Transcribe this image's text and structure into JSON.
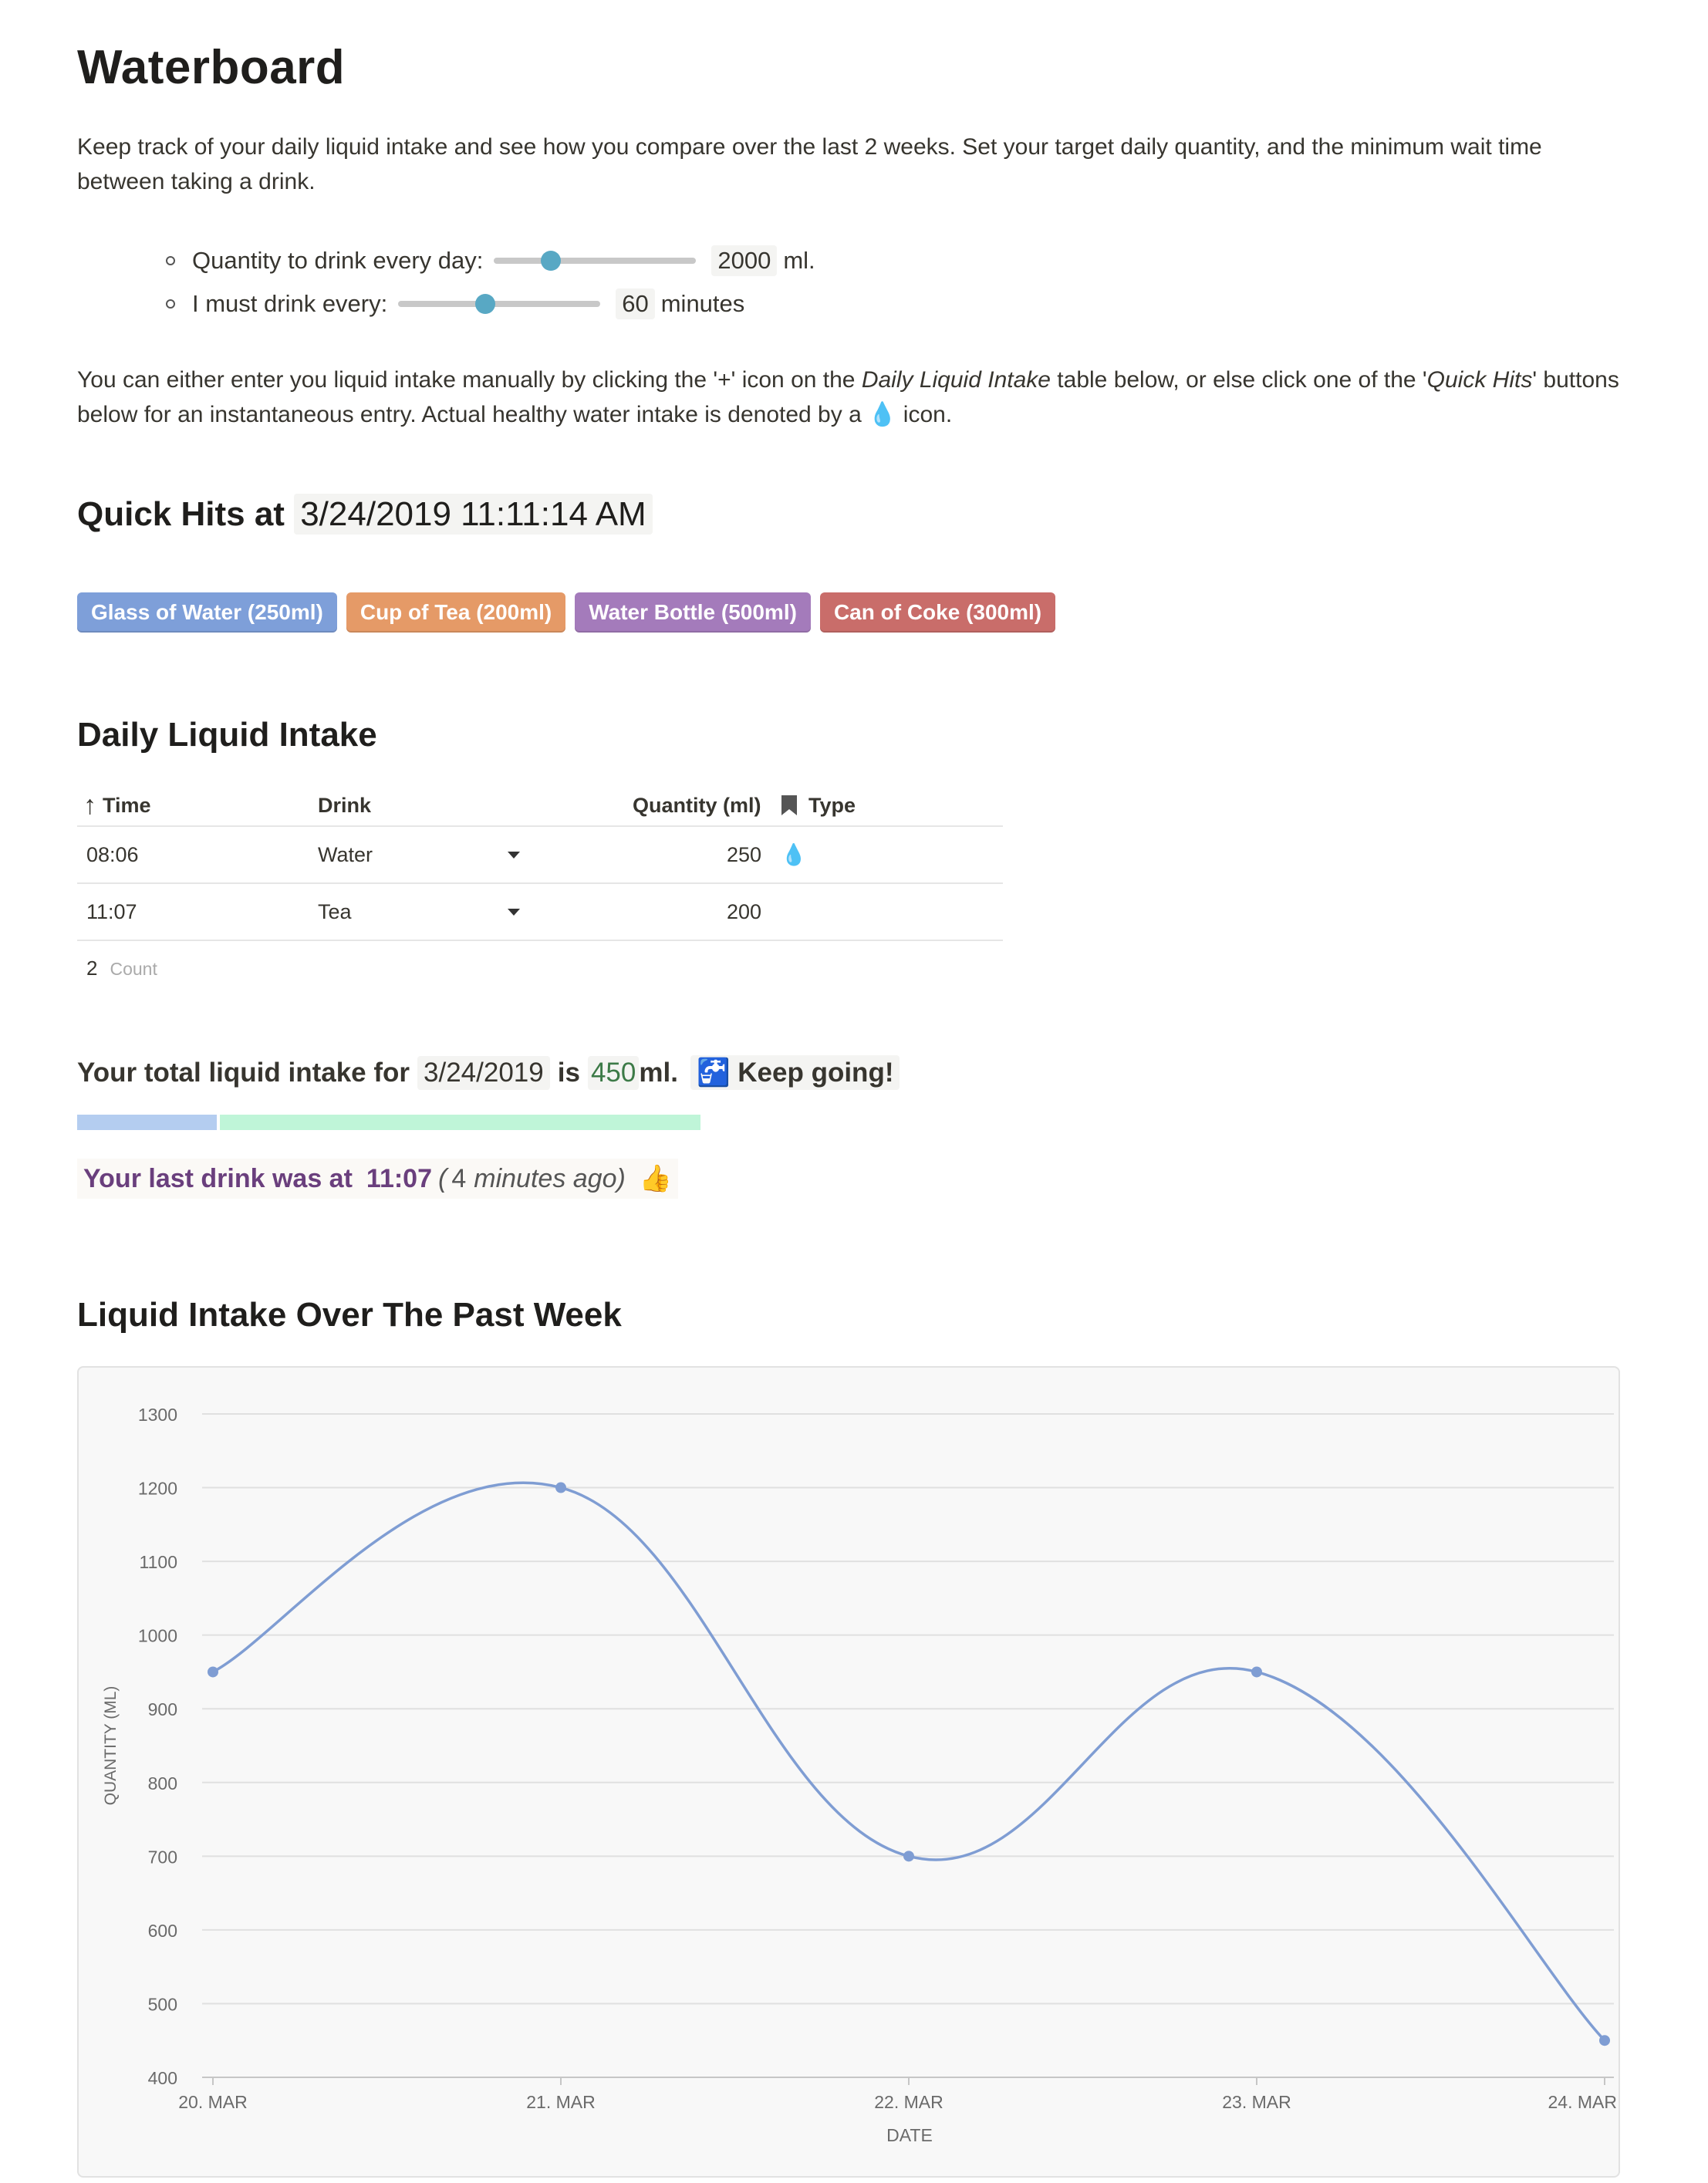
{
  "title": "Waterboard",
  "intro": "Keep track of your daily liquid intake and see how you compare over the last 2 weeks.  Set your target daily quantity, and the minimum wait time between taking a drink.",
  "settings": {
    "quantity": {
      "label": "Quantity to drink every day:",
      "value": "2000",
      "unit": "ml.",
      "slider_level": 0.28
    },
    "interval": {
      "label": "I must drink every:",
      "value": "60",
      "unit": "minutes",
      "slider_level": 0.43
    }
  },
  "instructions": {
    "part1": "You can either enter you liquid intake manually by clicking the '+' icon on the ",
    "table_name": "Daily Liquid Intake",
    "part2": " table below, or else click one of the '",
    "quick_hits": "Quick Hits",
    "part3": "' buttons below for an instantaneous entry. Actual healthy water intake is denoted by a ",
    "icon": "💧",
    "part4": " icon."
  },
  "quick_hits": {
    "heading": "Quick Hits at",
    "timestamp": "3/24/2019 11:11:14 AM",
    "buttons": [
      {
        "label": "Glass of Water (250ml)",
        "color": "#7e9fd9"
      },
      {
        "label": "Cup of Tea (200ml)",
        "color": "#e59a67"
      },
      {
        "label": "Water Bottle (500ml)",
        "color": "#a47bbb"
      },
      {
        "label": "Can of Coke (300ml)",
        "color": "#c96d6a"
      }
    ]
  },
  "daily": {
    "heading": "Daily Liquid Intake",
    "columns": {
      "time": "Time",
      "drink": "Drink",
      "quantity": "Quantity (ml)",
      "type": "Type"
    },
    "sort_icon": "↑",
    "rows": [
      {
        "time": "08:06",
        "drink": "Water",
        "quantity": "250",
        "type": "💧"
      },
      {
        "time": "11:07",
        "drink": "Tea",
        "quantity": "200",
        "type": ""
      }
    ],
    "count": "2",
    "count_label": "Count"
  },
  "total": {
    "prefix": "Your total liquid intake for",
    "date": "3/24/2019",
    "is": "is",
    "amount": "450",
    "unit": "ml.",
    "status_icon": "🚰",
    "status": "Keep going!",
    "progress_fraction": 0.225
  },
  "last_drink": {
    "prefix": "Your last drink was at",
    "time": "11:07",
    "open": "(",
    "minutes": "4",
    "suffix": "minutes ago)",
    "icon": "👍"
  },
  "week": {
    "heading": "Liquid Intake Over The Past Week"
  },
  "colors": {
    "line": "#7f9dd3",
    "grid": "#e0e0e0",
    "axis_text": "#6a6a6a"
  },
  "chart_data": {
    "type": "line",
    "categories": [
      "20. MAR",
      "21. MAR",
      "22. MAR",
      "23. MAR",
      "24. MAR"
    ],
    "values": [
      950,
      1200,
      700,
      950,
      450
    ],
    "xlabel": "DATE",
    "ylabel": "QUANTITY (ML)",
    "ylim": [
      400,
      1300
    ],
    "yticks": [
      400,
      500,
      600,
      700,
      800,
      900,
      1000,
      1100,
      1200,
      1300
    ],
    "grid": true
  }
}
